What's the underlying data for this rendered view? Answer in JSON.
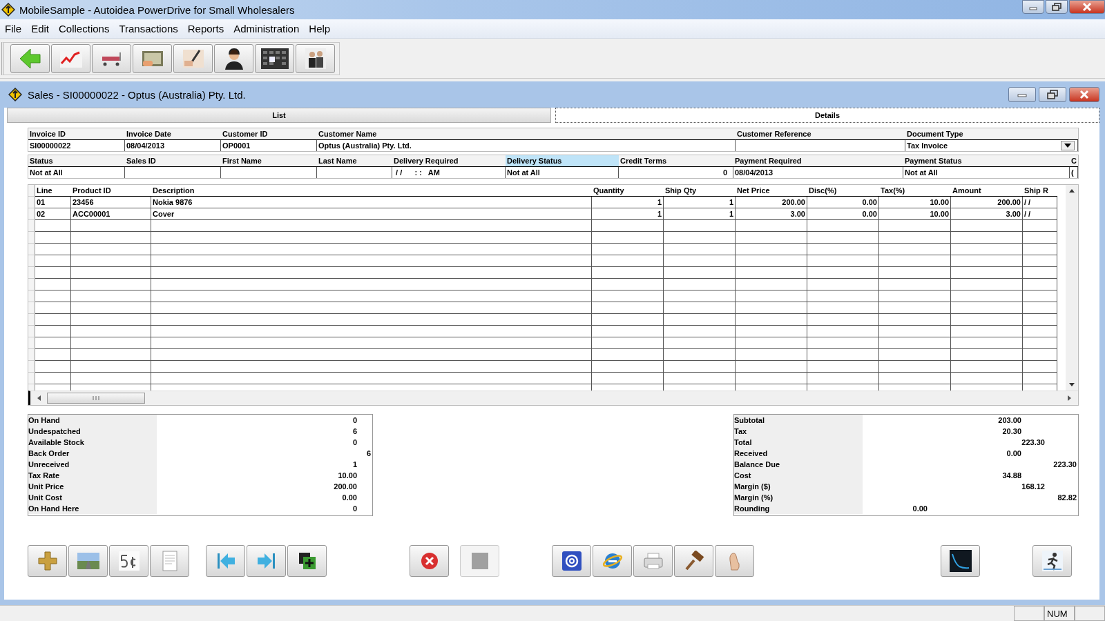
{
  "window": {
    "title": "MobileSample - Autoidea PowerDrive for Small Wholesalers"
  },
  "menu": [
    "File",
    "Edit",
    "Collections",
    "Transactions",
    "Reports",
    "Administration",
    "Help"
  ],
  "document": {
    "title": "Sales - SI00000022 - Optus (Australia) Pty. Ltd.",
    "tabs": [
      {
        "label": "List",
        "selected": false
      },
      {
        "label": "Details",
        "selected": true
      }
    ],
    "header_fields": [
      {
        "label": "Invoice ID",
        "value": "SI00000022",
        "kind": "text",
        "selected": false
      },
      {
        "label": "Invoice Date",
        "value": "08/04/2013",
        "kind": "text",
        "selected": false
      },
      {
        "label": "Customer ID",
        "value": "OP0001",
        "kind": "text",
        "selected": false
      },
      {
        "label": "Customer Name",
        "value": "Optus (Australia) Pty. Ltd.",
        "kind": "text",
        "selected": false
      },
      {
        "label": "Customer Reference",
        "kind": "text",
        "selected": false
      },
      {
        "label": "Document Type",
        "value": "Tax Invoice",
        "kind": "dropdown",
        "selected": false
      }
    ],
    "status_fields": [
      {
        "label": "Status",
        "value": "Not at All",
        "kind": "text",
        "selected": false
      },
      {
        "label": "Sales ID",
        "kind": "text",
        "selected": false
      },
      {
        "label": "First Name",
        "kind": "text",
        "selected": false
      },
      {
        "label": "Last Name",
        "kind": "text",
        "selected": false
      },
      {
        "label": "Delivery Required",
        "value": " / /      : :   AM",
        "kind": "text",
        "selected": false
      },
      {
        "label": "Delivery Status",
        "value": "Not at All",
        "kind": "text",
        "selected": true
      },
      {
        "label": "Credit Terms",
        "value": "0",
        "kind": "number",
        "selected": false
      },
      {
        "label": "Payment Required",
        "value": "08/04/2013",
        "kind": "text",
        "selected": false
      },
      {
        "label": "Payment Status",
        "value": "Not at All",
        "kind": "text",
        "selected": false
      },
      {
        "label": "C",
        "value": "(",
        "kind": "text",
        "selected": false
      }
    ],
    "table": {
      "columns": [
        "Line",
        "Product ID",
        "Description",
        "Quantity",
        "Ship Qty",
        "Net Price",
        "Disc(%)",
        "Tax(%)",
        "Amount",
        "Ship R"
      ],
      "rows": [
        [
          "01",
          "23456",
          "Nokia 9876",
          "1",
          "1",
          "200.00",
          "0.00",
          "10.00",
          "200.00",
          "/ /"
        ],
        [
          "02",
          "ACC00001",
          "Cover",
          "1",
          "1",
          "3.00",
          "0.00",
          "10.00",
          "3.00",
          "/ /"
        ]
      ]
    },
    "stock_summary": [
      {
        "label": "On Hand",
        "value": "0",
        "kind": "first"
      },
      {
        "label": "Undespatched",
        "value": "6",
        "kind": "first"
      },
      {
        "label": "Available Stock",
        "value": "0",
        "kind": "first"
      },
      {
        "label": "Back Order",
        "value": "6",
        "kind": "second"
      },
      {
        "label": "Unreceived",
        "value": "1",
        "kind": "first"
      },
      {
        "label": "Tax Rate",
        "value": "10.00",
        "kind": "first"
      },
      {
        "label": "Unit Price",
        "value": "200.00",
        "kind": "first"
      },
      {
        "label": "Unit Cost",
        "value": "0.00",
        "kind": "first"
      },
      {
        "label": "On Hand Here",
        "value": "0",
        "kind": "first"
      }
    ],
    "totals_summary": [
      {
        "label": "Subtotal",
        "value": "203.00",
        "kind": "first"
      },
      {
        "label": "Tax",
        "value": "20.30",
        "kind": "first"
      },
      {
        "label": "Total",
        "value": "223.30",
        "kind": "second"
      },
      {
        "label": "Received",
        "value": "0.00",
        "kind": "first"
      },
      {
        "label": "Balance Due",
        "value": "223.30",
        "kind": "third"
      },
      {
        "label": "Cost",
        "value": "34.88",
        "kind": "first"
      },
      {
        "label": "Margin ($)",
        "value": "168.12",
        "kind": "second"
      },
      {
        "label": "Margin (%)",
        "value": "82.82",
        "kind": "third"
      },
      {
        "label": "Rounding",
        "value": "0.00",
        "kind": "left"
      }
    ]
  },
  "status_bar": [
    "NUM"
  ]
}
